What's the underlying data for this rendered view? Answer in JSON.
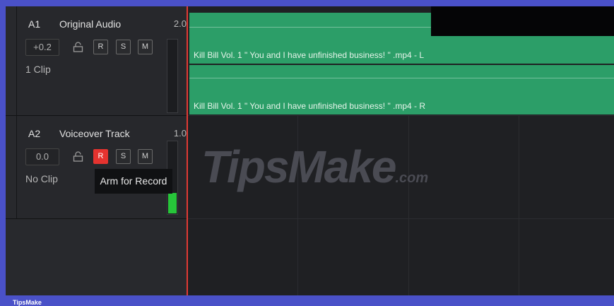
{
  "tracks": [
    {
      "id": "A1",
      "name": "Original Audio",
      "channels": "2.0",
      "volume": "+0.2",
      "clip_count": "1 Clip",
      "buttons": {
        "record": "R",
        "solo": "S",
        "mute": "M"
      },
      "record_armed": false,
      "meter_level": 0
    },
    {
      "id": "A2",
      "name": "Voiceover Track",
      "channels": "1.0",
      "volume": "0.0",
      "clip_count": "No Clip",
      "buttons": {
        "record": "R",
        "solo": "S",
        "mute": "M"
      },
      "record_armed": true,
      "meter_level": 0.28
    }
  ],
  "tooltip": "Arm for Record",
  "timeline": {
    "clips": [
      {
        "title": "Kill Bill Vol. 1  \" You and I have unfinished business! \" .mp4 - L"
      },
      {
        "title": "Kill Bill Vol. 1  \" You and I have unfinished business! \" .mp4 - R"
      }
    ]
  },
  "watermark": {
    "main": "TipsMake",
    "suffix": ".com"
  },
  "footer_brand": "TipsMake",
  "colors": {
    "clip": "#2c9e68",
    "record_armed": "#e5332f",
    "playhead": "#e23a34",
    "meter": "#27c53a",
    "outer_frame": "#4a51c8"
  }
}
